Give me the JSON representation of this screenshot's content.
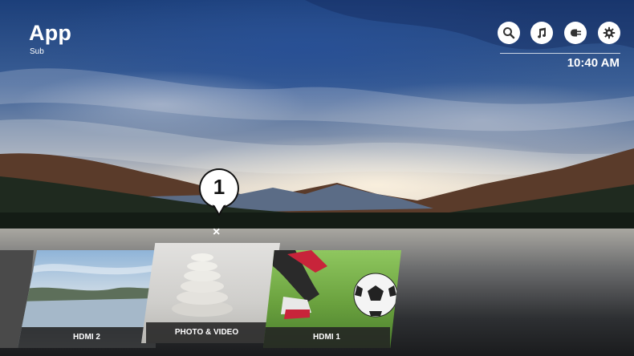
{
  "header": {
    "title": "App",
    "subtitle": "Sub",
    "clock": "10:40 AM",
    "icons": [
      "search-icon",
      "music-icon",
      "input-source-icon",
      "settings-icon"
    ]
  },
  "callout": {
    "number": "1",
    "close_glyph": "×"
  },
  "cards": [
    {
      "label": "HDMI 2",
      "image": "landscape-lake"
    },
    {
      "label": "PHOTO & VIDEO",
      "image": "stacked-stones"
    },
    {
      "label": "HDMI 1",
      "image": "soccer-ball"
    }
  ],
  "colors": {
    "icon_bg": "#ffffff",
    "label_bg": "#232323",
    "text": "#ffffff"
  }
}
